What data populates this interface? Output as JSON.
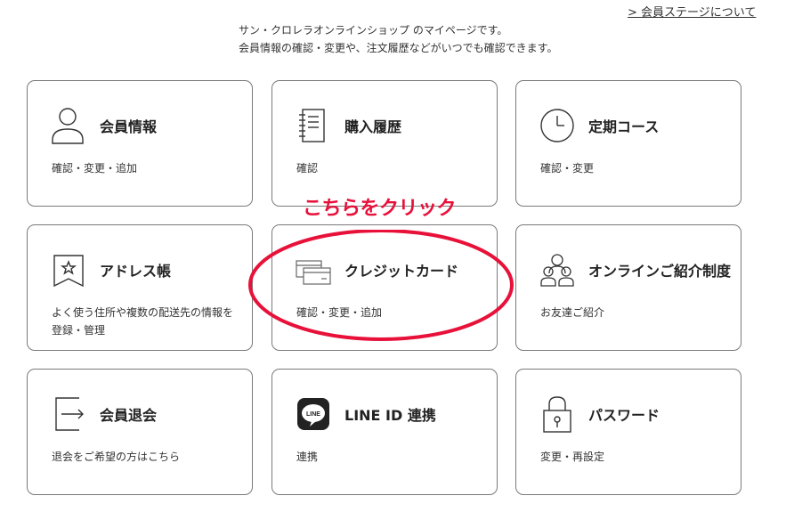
{
  "header": {
    "stage_link": "> 会員ステージについて",
    "intro_line1": "サン・クロレラオンラインショップ のマイページです。",
    "intro_line2": "会員情報の確認・変更や、注文履歴などがいつでも確認できます。"
  },
  "cards": [
    {
      "title": "会員情報",
      "desc": "確認・変更・追加",
      "icon": "user-icon"
    },
    {
      "title": "購入履歴",
      "desc": "確認",
      "icon": "notebook-icon"
    },
    {
      "title": "定期コース",
      "desc": "確認・変更",
      "icon": "clock-icon"
    },
    {
      "title": "アドレス帳",
      "desc": "よく使う住所や複数の配送先の情報を登録・管理",
      "icon": "bookmark-star-icon"
    },
    {
      "title": "クレジットカード",
      "desc": "確認・変更・追加",
      "icon": "credit-card-icon"
    },
    {
      "title": "オンラインご紹介制度",
      "desc": "お友達ご紹介",
      "icon": "people-group-icon"
    },
    {
      "title": "会員退会",
      "desc": "退会をご希望の方はこちら",
      "icon": "exit-arrow-icon"
    },
    {
      "title": "LINE ID 連携",
      "desc": "連携",
      "icon": "line-logo-icon",
      "icon_text": "LINE"
    },
    {
      "title": "パスワード",
      "desc": "変更・再設定",
      "icon": "padlock-icon"
    }
  ],
  "annotation": {
    "text": "こちらをクリック",
    "color": "#e8113a"
  }
}
